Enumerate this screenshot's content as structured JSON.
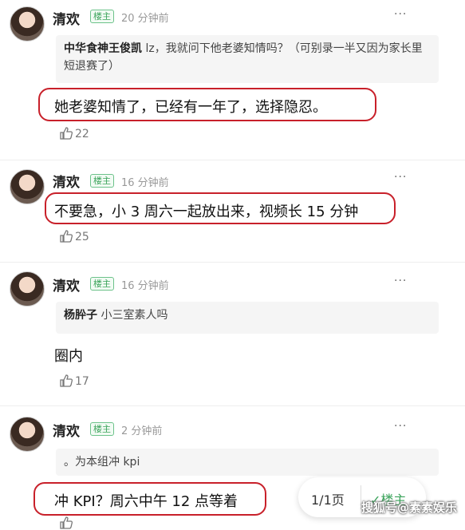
{
  "comments": [
    {
      "name": "清欢",
      "badge": "楼主",
      "time": "20 分钟前",
      "quote_author": "中华食神王俊凯",
      "quote_text": " lz，我就问下他老婆知情吗？（可别录一半又因为家长里短退赛了）",
      "text": "她老婆知情了，已经有一年了，选择隐忍。",
      "likes": "22"
    },
    {
      "name": "清欢",
      "badge": "楼主",
      "time": "16 分钟前",
      "text": "不要急，小 3 周六一起放出来，视频长 15 分钟",
      "likes": "25"
    },
    {
      "name": "清欢",
      "badge": "楼主",
      "time": "16 分钟前",
      "quote_author": "杨肸子",
      "quote_text": " 小三室素人吗",
      "text": "圈内",
      "likes": "17"
    },
    {
      "name": "清欢",
      "badge": "楼主",
      "time": "2 分钟前",
      "quote_text": "。为本组冲 kpi",
      "text": "冲 KPI？周六中午 12 点等着"
    }
  ],
  "more_icon": "···",
  "pager": {
    "page": "1/1页",
    "op_only": "楼主"
  },
  "watermark": "搜狐号@素素娱乐"
}
